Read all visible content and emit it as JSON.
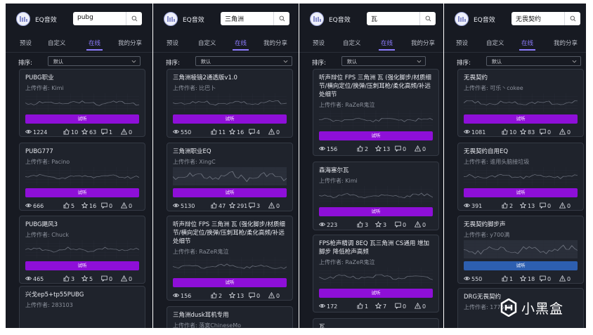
{
  "app": {
    "title": "EQ音效"
  },
  "tabs": [
    "预设",
    "自定义",
    "在线",
    "我的分享"
  ],
  "sort": {
    "label": "排序:",
    "value": "默认"
  },
  "try_label": "试听",
  "author_prefix": "上传作者:",
  "watermark": "小黑盒",
  "panels": [
    {
      "query": "pubg",
      "cards": [
        {
          "title": "PUBG职业",
          "author": "Kimi",
          "views": "1224",
          "likes": "10",
          "stars": "63",
          "comments": "1",
          "warns": "0"
        },
        {
          "title": "PUBG777",
          "author": "Pacino",
          "views": "666",
          "likes": "5",
          "stars": "16",
          "comments": "0",
          "warns": "0"
        },
        {
          "title": "PUBG飓风3",
          "author": "Chuck",
          "views": "465",
          "likes": "3",
          "stars": "5",
          "comments": "0",
          "warns": "0"
        },
        {
          "title": "兴戈ep5+tp55PUBG",
          "author": "283103"
        }
      ]
    },
    {
      "query": "三角洲",
      "cards": [
        {
          "title": "三角洲棱镜2通透版v1.0",
          "author": "比巴卜",
          "views": "550",
          "likes": "11",
          "stars": "16",
          "comments": "4",
          "warns": "0"
        },
        {
          "title": "三角洲职业EQ",
          "author": "XingC",
          "views": "5130",
          "likes": "47",
          "stars": "291",
          "comments": "3",
          "warns": "0"
        },
        {
          "title": "听声辩位 FPS 三角洲 瓦 (强化脚步/材质细节/横向定位/换弹/压刺耳枪/柔化高频/补远处细节",
          "author": "RaZeR鬼泣",
          "views": "156",
          "likes": "2",
          "stars": "13",
          "comments": "0",
          "warns": "0"
        },
        {
          "title": "三角洲dusk耳机专用",
          "author": "落寞ChineseMo"
        }
      ]
    },
    {
      "query": "瓦",
      "cards": [
        {
          "title": "听声辩位 FPS 三角洲 瓦 (强化脚步/材质细节/横向定位/换弹/压刺耳枪/柔化高频/补远处细节",
          "author": "RaZeR鬼泣",
          "views": "156",
          "likes": "2",
          "stars": "13",
          "comments": "0",
          "warns": "0"
        },
        {
          "title": "森海塞尔瓦",
          "author": "Kimi",
          "views": "223",
          "likes": "3",
          "stars": "3",
          "comments": "0",
          "warns": "0"
        },
        {
          "title": "FPS枪声精调 8EQ 瓦三角洲 CS通用 增加脚步 降低枪声高频",
          "author": "RaZeR鬼泣",
          "views": "172",
          "likes": "1",
          "stars": "7",
          "comments": "0",
          "warns": "0"
        },
        {
          "title": "瓦",
          "author": ""
        }
      ]
    },
    {
      "query": "无畏契约",
      "cards": [
        {
          "title": "无畏契约",
          "author": "可乐丶cokee",
          "views": "1081",
          "likes": "10",
          "stars": "83",
          "comments": "0",
          "warns": "0"
        },
        {
          "title": "无畏契约自用EQ",
          "author": "谁用头脑接垃圾",
          "views": "391",
          "likes": "2",
          "stars": "13",
          "comments": "0",
          "warns": "0"
        },
        {
          "title": "无畏契约脚步声",
          "author": "y700满",
          "views": "550",
          "likes": "1",
          "stars": "18",
          "comments": "0",
          "warns": "0"
        },
        {
          "title": "DRG无畏契约",
          "author": "177585"
        }
      ]
    }
  ],
  "colors": {
    "panel_bg": "#171a22",
    "card_bg": "#1f232c",
    "accent": "#8d7cff",
    "try_button": "#8e0fd8",
    "try_button_active": "#2d5fb0"
  }
}
